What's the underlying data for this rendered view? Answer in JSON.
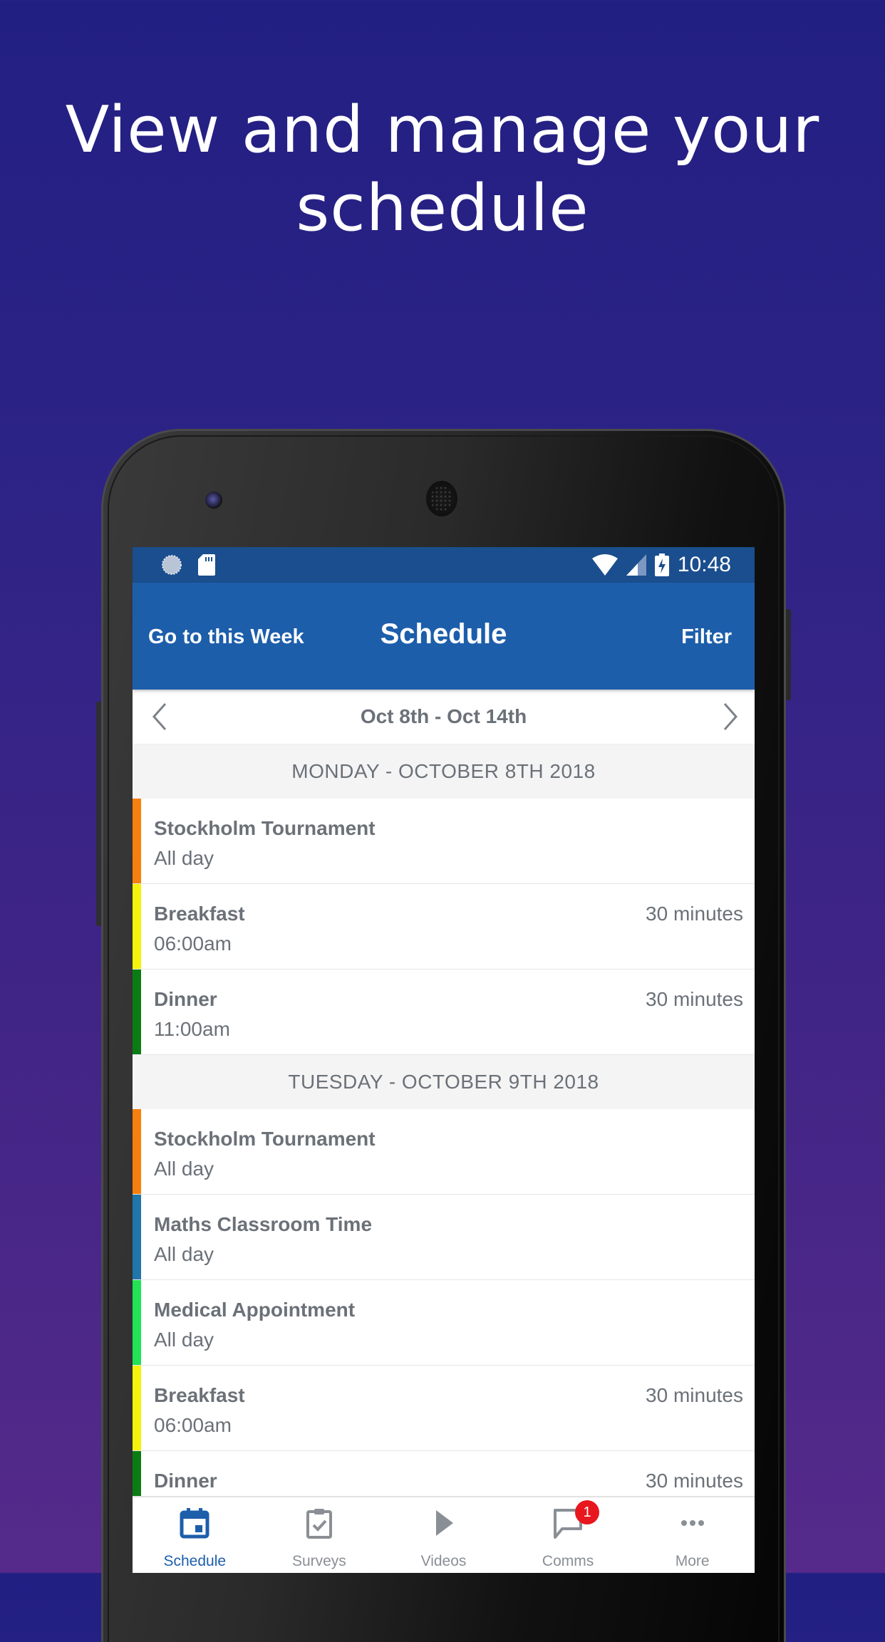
{
  "headline": {
    "line1": "View and manage your",
    "line2": "schedule"
  },
  "status_bar": {
    "time": "10:48",
    "icons": [
      "loading-icon",
      "sd-card-icon",
      "wifi-icon",
      "signal-icon",
      "battery-charging-icon"
    ]
  },
  "app_bar": {
    "left_button": "Go to this Week",
    "title": "Schedule",
    "right_button": "Filter"
  },
  "date_nav": {
    "range": "Oct 8th - Oct 14th",
    "prev_icon": "chevron-left-icon",
    "next_icon": "chevron-right-icon"
  },
  "days": [
    {
      "header": "MONDAY - OCTOBER 8TH 2018",
      "events": [
        {
          "name": "Stockholm Tournament",
          "time": "All day",
          "duration": "",
          "color": "#f77f0e"
        },
        {
          "name": "Breakfast",
          "time": "06:00am",
          "duration": "30 minutes",
          "color": "#f3f30b"
        },
        {
          "name": "Dinner",
          "time": "11:00am",
          "duration": "30 minutes",
          "color": "#0b7c14"
        }
      ]
    },
    {
      "header": "TUESDAY - OCTOBER 9TH 2018",
      "events": [
        {
          "name": "Stockholm Tournament",
          "time": "All day",
          "duration": "",
          "color": "#f77f0e"
        },
        {
          "name": "Maths Classroom Time",
          "time": "All day",
          "duration": "",
          "color": "#2075ab"
        },
        {
          "name": "Medical Appointment",
          "time": "All day",
          "duration": "",
          "color": "#22e255"
        },
        {
          "name": "Breakfast",
          "time": "06:00am",
          "duration": "30 minutes",
          "color": "#f3f30b"
        },
        {
          "name": "Dinner",
          "time": "",
          "duration": "30 minutes",
          "color": "#0b7c14"
        }
      ]
    }
  ],
  "bottom_nav": {
    "items": [
      {
        "label": "Schedule",
        "icon": "calendar-icon",
        "active": true
      },
      {
        "label": "Surveys",
        "icon": "clipboard-check-icon",
        "active": false
      },
      {
        "label": "Videos",
        "icon": "play-icon",
        "active": false
      },
      {
        "label": "Comms",
        "icon": "chat-bubble-icon",
        "active": false,
        "badge": "1"
      },
      {
        "label": "More",
        "icon": "more-dots-icon",
        "active": false
      }
    ]
  },
  "colors": {
    "primary": "#1d5eab",
    "status_bar": "#1a4e8e",
    "badge": "#e8161d",
    "text_gray": "#6b7178"
  }
}
